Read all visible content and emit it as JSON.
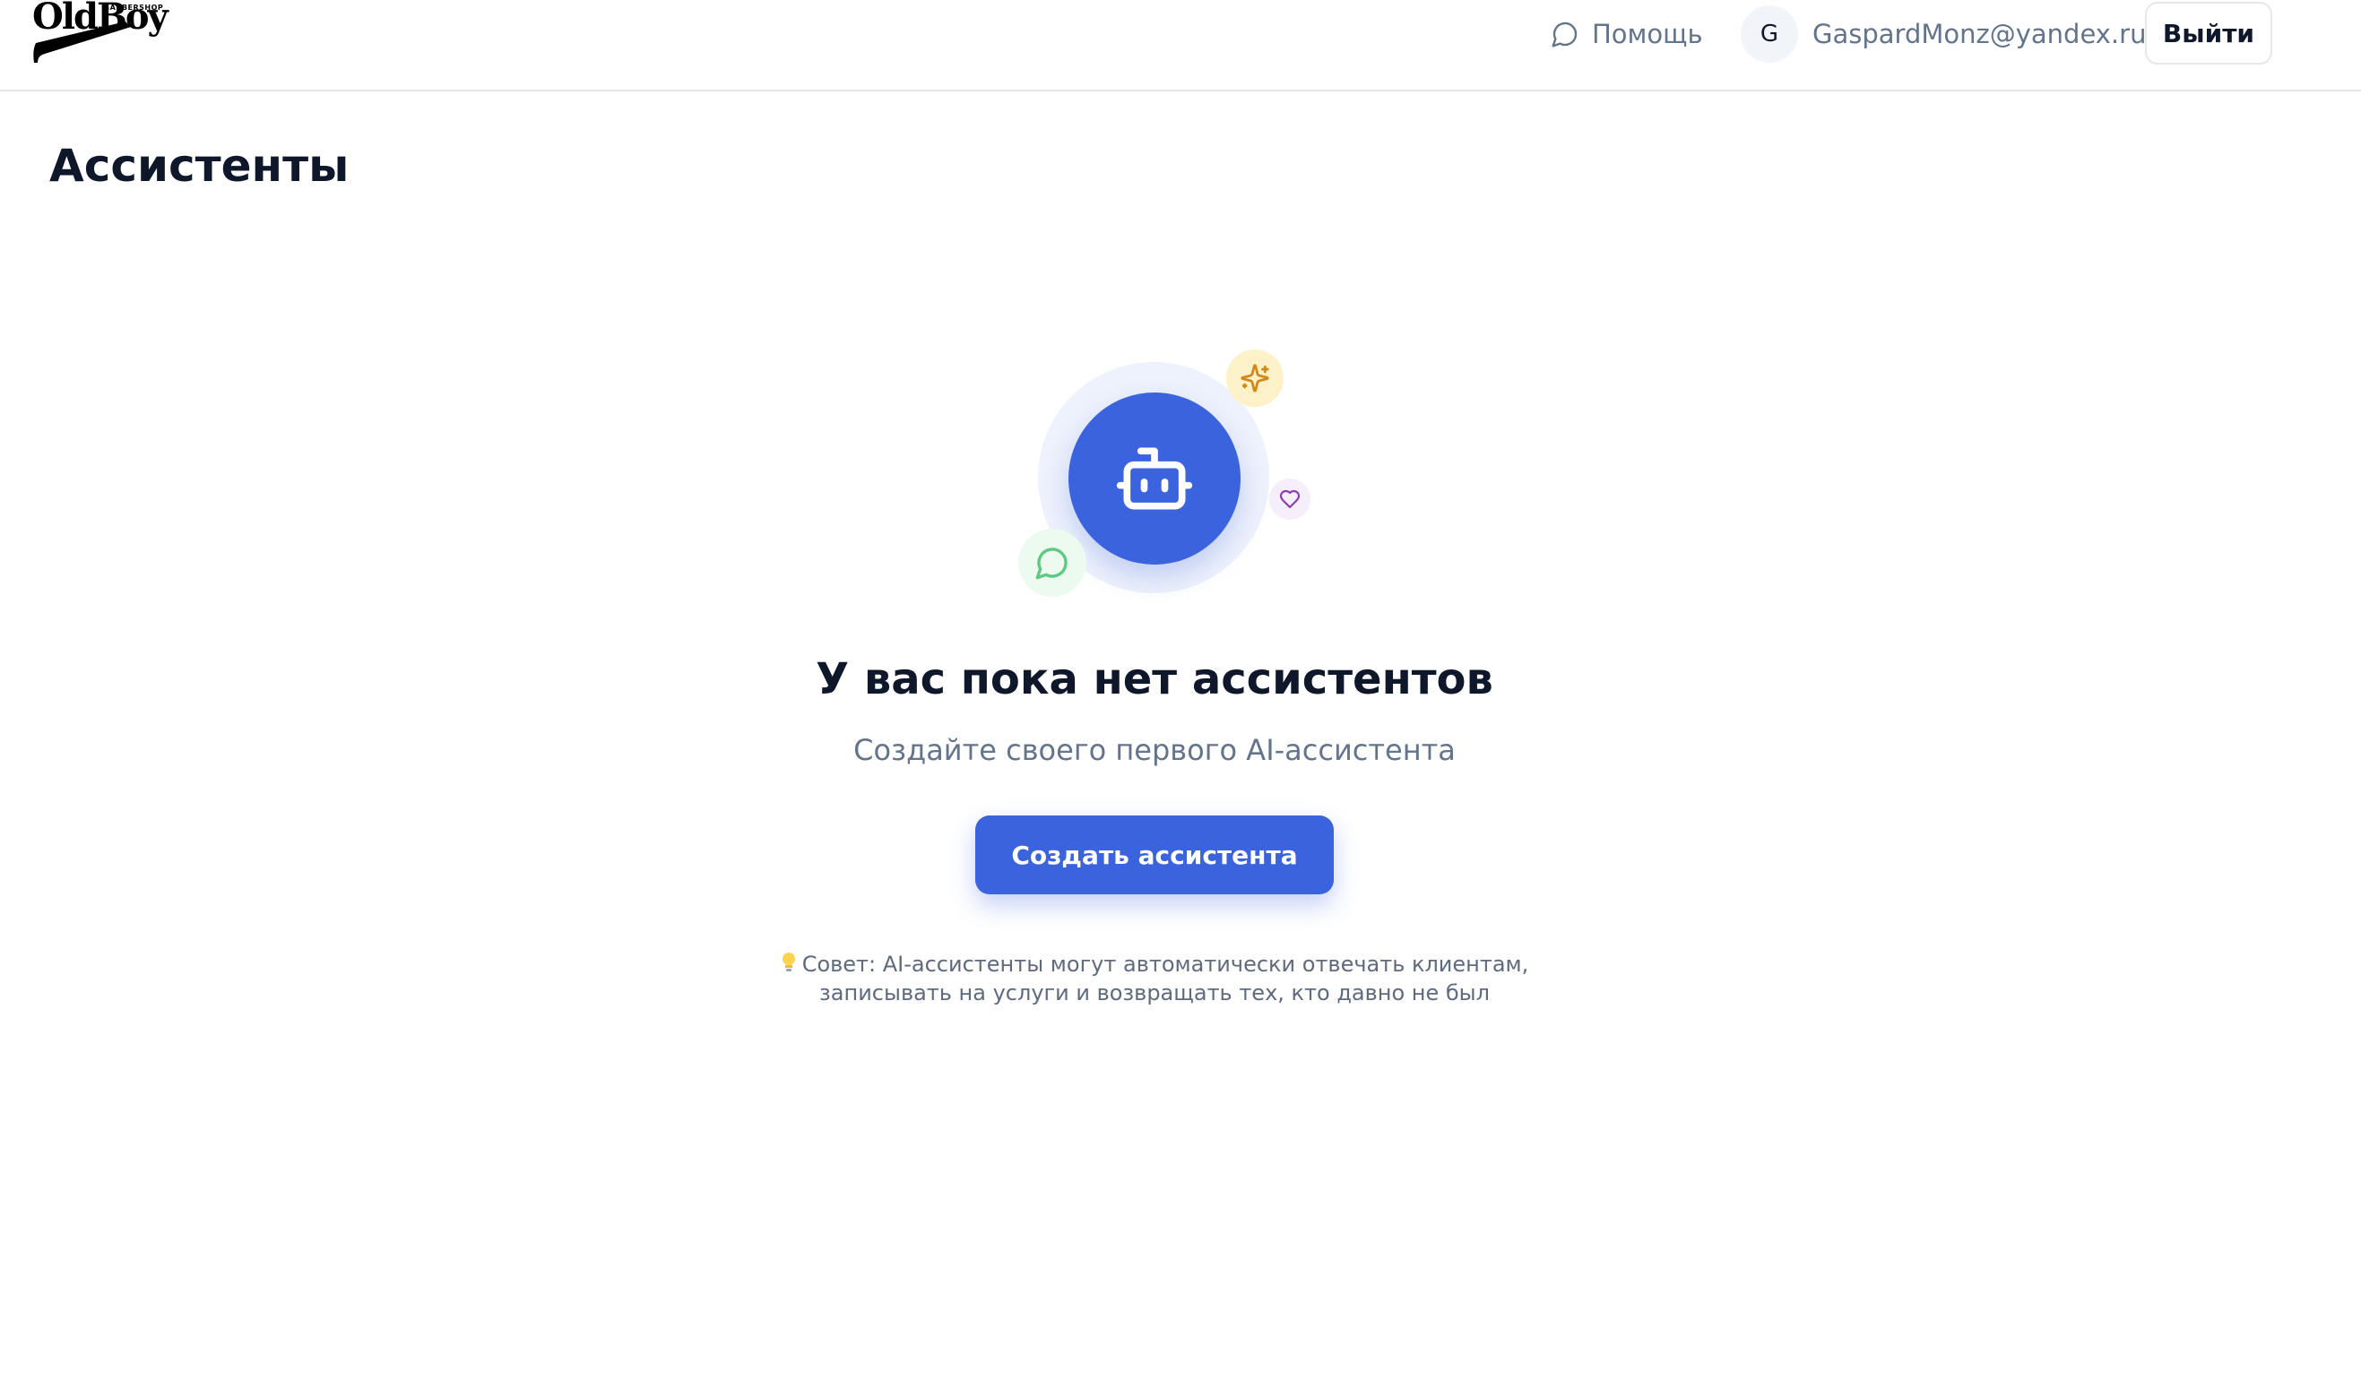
{
  "header": {
    "logo": {
      "text": "OldBoy",
      "subtext": "BARBERSHOP"
    },
    "help_label": "Помощь",
    "user": {
      "avatar_initial": "G",
      "email": "GaspardMonz@yandex.ru"
    },
    "logout_label": "Выйти"
  },
  "page": {
    "title": "Ассистенты"
  },
  "empty_state": {
    "title": "У вас пока нет ассистентов",
    "subtitle": "Создайте своего первого AI-ассистента",
    "create_button_label": "Создать ассистента",
    "tip_line_1": "Совет: AI-ассистенты могут автоматически отвечать клиентам,",
    "tip_line_2": "записывать на услуги и возвращать тех, кто давно не был"
  },
  "icons": {
    "help": "chat-bubble-icon",
    "robot": "robot-icon",
    "sparkle": "sparkles-icon",
    "heart": "heart-icon",
    "chat": "chat-bubble-icon",
    "tip": "lightbulb-icon"
  },
  "colors": {
    "primary": "#3a63dd",
    "text": "#0f172a",
    "muted": "#64748b",
    "sparkle_badge": "#fdf1c8",
    "heart_badge": "#f6eefb",
    "chat_badge": "#ecfaf0"
  }
}
